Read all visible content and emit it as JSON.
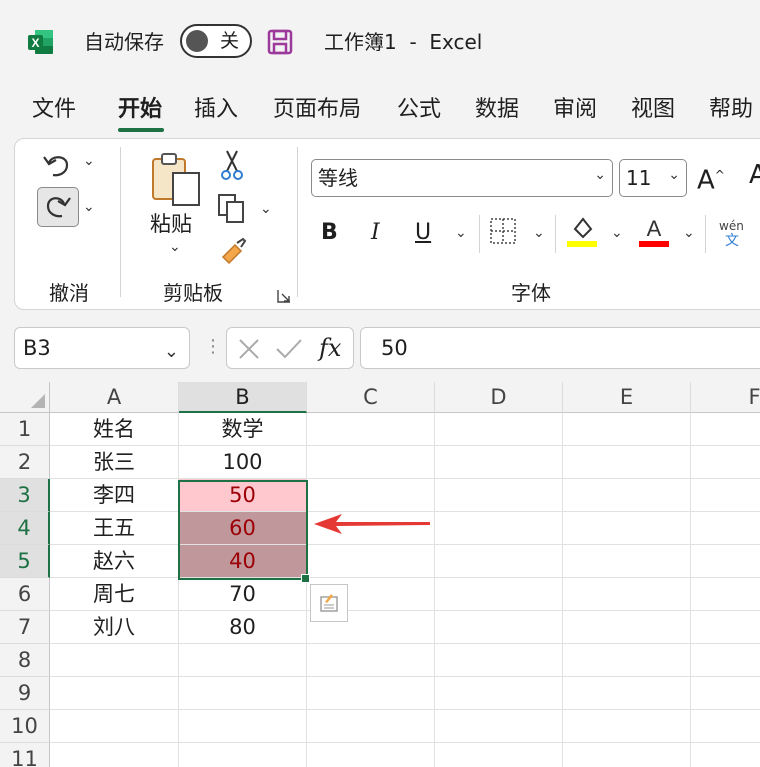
{
  "titlebar": {
    "autosave_label": "自动保存",
    "autosave_state": "关",
    "workbook_title": "工作簿1  -  Excel"
  },
  "menu": {
    "tabs": [
      "文件",
      "开始",
      "插入",
      "页面布局",
      "公式",
      "数据",
      "审阅",
      "视图",
      "帮助"
    ],
    "active": "开始"
  },
  "ribbon": {
    "undo_group": "撤消",
    "clipboard_group": "剪贴板",
    "paste_label": "粘贴",
    "font_group": "字体",
    "font_name": "等线",
    "font_size": "11",
    "bold": "B",
    "italic": "I",
    "underline": "U",
    "phonetic_top": "wén",
    "phonetic_bottom": "文",
    "fill_color": "#ffff00",
    "font_color": "#ff0000"
  },
  "formula_bar": {
    "name_box": "B3",
    "value": "50"
  },
  "sheet": {
    "columns": [
      "A",
      "B",
      "C",
      "D",
      "E",
      "F"
    ],
    "rows": [
      "1",
      "2",
      "3",
      "4",
      "5",
      "6",
      "7",
      "8",
      "9",
      "10",
      "11"
    ],
    "data": [
      [
        "姓名",
        "数学"
      ],
      [
        "张三",
        "100"
      ],
      [
        "李四",
        "50"
      ],
      [
        "王五",
        "60"
      ],
      [
        "赵六",
        "40"
      ],
      [
        "周七",
        "70"
      ],
      [
        "刘八",
        "80"
      ]
    ],
    "highlight_colors": {
      "light": "#ffc7ce",
      "dark": "#c0989c",
      "text": "#9c0006"
    },
    "selection_color": "#1e7145"
  }
}
